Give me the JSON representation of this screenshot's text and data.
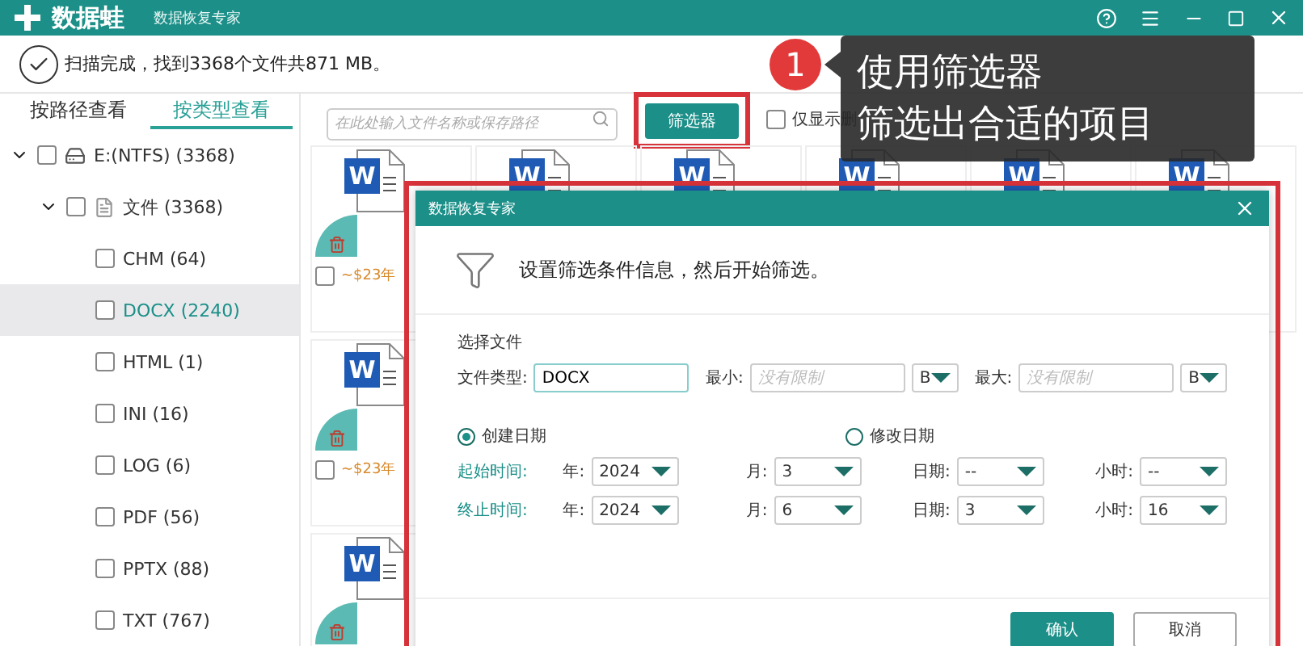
{
  "app": {
    "logo": "数据蛙",
    "subtitle": "数据恢复专家"
  },
  "status": {
    "message": "扫描完成，找到3368个文件共871 MB。"
  },
  "tabs": [
    {
      "label": "按路径查看",
      "selected": false
    },
    {
      "label": "按类型查看",
      "selected": true
    }
  ],
  "tree": [
    {
      "label": "E:(NTFS) (3368)",
      "kind": "drive",
      "checked": false,
      "expanded": true,
      "selected": false,
      "children": [
        {
          "label": "文件 (3368)",
          "kind": "folder",
          "checked": false,
          "expanded": true,
          "selected": false,
          "children": [
            {
              "label": "CHM (64)",
              "checked": false,
              "selected": false
            },
            {
              "label": "DOCX (2240)",
              "checked": false,
              "selected": true
            },
            {
              "label": "HTML (1)",
              "checked": false,
              "selected": false
            },
            {
              "label": "INI (16)",
              "checked": false,
              "selected": false
            },
            {
              "label": "LOG (6)",
              "checked": false,
              "selected": false
            },
            {
              "label": "PDF (56)",
              "checked": false,
              "selected": false
            },
            {
              "label": "PPTX (88)",
              "checked": false,
              "selected": false
            },
            {
              "label": "TXT (767)",
              "checked": false,
              "selected": false
            }
          ]
        }
      ]
    }
  ],
  "search": {
    "placeholder": "在此处输入文件名称或保存路径"
  },
  "filter_button": {
    "label": "筛选器",
    "highlighted": true
  },
  "deleted_only": {
    "label": "仅显示删",
    "checked": false
  },
  "file_grid": {
    "rows": [
      [
        {
          "icon_letter": "W",
          "deleted": true,
          "name": "~$23年",
          "checked": false
        },
        {
          "icon_letter": "W"
        },
        {
          "icon_letter": "W"
        },
        {
          "icon_letter": "W"
        },
        {
          "icon_letter": "W"
        },
        {
          "icon_letter": "W"
        }
      ],
      [
        {
          "icon_letter": "W",
          "deleted": true,
          "name": "~$23年",
          "checked": false
        }
      ],
      [
        {
          "icon_letter": "W",
          "deleted": true
        }
      ]
    ]
  },
  "callout": {
    "number": "1",
    "lines": [
      "使用筛选器",
      "筛选出合适的项目"
    ]
  },
  "dialog": {
    "title": "数据恢复专家",
    "highlighted": true,
    "intro": "设置筛选条件信息，然后开始筛选。",
    "section": "选择文件",
    "type_label": "文件类型:",
    "type_value": "DOCX",
    "min_label": "最小:",
    "min_placeholder": "没有限制",
    "min_unit": "B",
    "max_label": "最大:",
    "max_placeholder": "没有限制",
    "max_unit": "B",
    "date_modes": [
      {
        "label": "创建日期",
        "selected": true
      },
      {
        "label": "修改日期",
        "selected": false
      }
    ],
    "time_rows": [
      {
        "label": "起始时间:",
        "fields": [
          {
            "label": "年:",
            "value": "2024"
          },
          {
            "label": "月:",
            "value": "3"
          },
          {
            "label": "日期:",
            "value": "--"
          },
          {
            "label": "小时:",
            "value": "--"
          }
        ]
      },
      {
        "label": "终止时间:",
        "fields": [
          {
            "label": "年:",
            "value": "2024"
          },
          {
            "label": "月:",
            "value": "6"
          },
          {
            "label": "日期:",
            "value": "3"
          },
          {
            "label": "小时:",
            "value": "16"
          }
        ]
      }
    ],
    "buttons": [
      {
        "label": "确认",
        "kind": "primary"
      },
      {
        "label": "取消",
        "kind": "secondary"
      }
    ]
  }
}
